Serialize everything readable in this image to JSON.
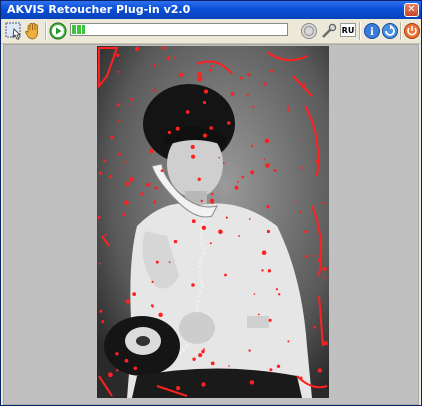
{
  "window": {
    "title": "AKVIS Retoucher Plug-in v2.0"
  },
  "toolbar": {
    "language": "RU",
    "progress": 0.06,
    "icons": [
      "select-region-icon",
      "hand-icon",
      "run-icon",
      "stop-icon",
      "settings-icon",
      "language-icon",
      "info-icon",
      "help-icon",
      "power-icon"
    ]
  },
  "colors": {
    "title_bar": "#0a4fd6",
    "mark_red": "#ff2020",
    "canvas_bg": "#c0c0c0"
  }
}
